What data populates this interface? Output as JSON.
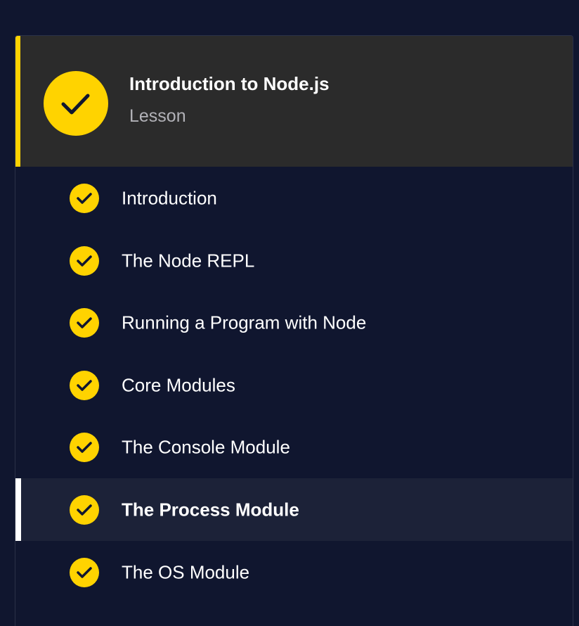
{
  "lesson": {
    "title": "Introduction to Node.js",
    "subtitle": "Lesson",
    "status_icon": "check-circle-icon",
    "accent_color": "#ffd300"
  },
  "items": [
    {
      "label": "Introduction",
      "completed": true,
      "active": false
    },
    {
      "label": "The Node REPL",
      "completed": true,
      "active": false
    },
    {
      "label": "Running a Program with Node",
      "completed": true,
      "active": false
    },
    {
      "label": "Core Modules",
      "completed": true,
      "active": false
    },
    {
      "label": "The Console Module",
      "completed": true,
      "active": false
    },
    {
      "label": "The Process Module",
      "completed": true,
      "active": true
    },
    {
      "label": "The OS Module",
      "completed": true,
      "active": false
    }
  ],
  "colors": {
    "background": "#10162f",
    "header_background": "#2b2b2b",
    "check": "#ffd300",
    "active_row": "#1c2238"
  }
}
